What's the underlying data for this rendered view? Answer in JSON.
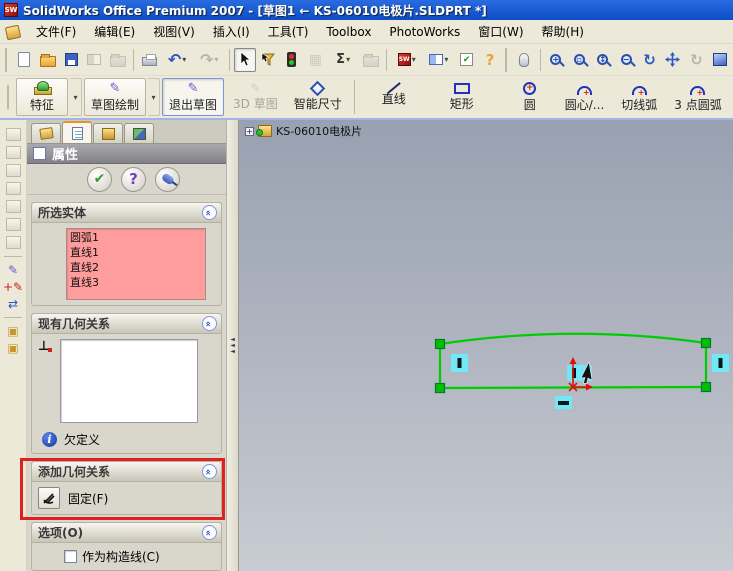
{
  "window": {
    "title": "SolidWorks Office Premium 2007 - [草图1 ← KS-06010电极片.SLDPRT *]"
  },
  "menu": {
    "items": [
      "文件(F)",
      "编辑(E)",
      "视图(V)",
      "插入(I)",
      "工具(T)",
      "Toolbox",
      "PhotoWorks",
      "窗口(W)",
      "帮助(H)"
    ]
  },
  "glyphs": {
    "undo": "↶",
    "redo": "↷",
    "dropdown": "▾",
    "sigma": "Σ",
    "help": "?",
    "rotate": "↻",
    "sw_logo": "SW",
    "grid": "▦",
    "pencil": "✎",
    "check": "✔",
    "zoom_fit": "+",
    "zoom_area": "▫",
    "zoom_inout": "↕",
    "zoom_sel": "−",
    "chevron": "»",
    "perpendicular": "⊥",
    "info": "i",
    "circle_plus": "+",
    "expand": "+",
    "three_d": "3D",
    "splitter": "◄"
  },
  "main_toolbar": {
    "icon_names": [
      "new",
      "open",
      "save",
      "make-drawing",
      "make-assembly",
      "print",
      "undo",
      "redo",
      "select",
      "selection-filter",
      "stop-macro",
      "grid",
      "measure",
      "unknown-disabled",
      "solidworks-resources",
      "split-window",
      "options",
      "help",
      "select-tool",
      "zoom-to-fit",
      "zoom-to-area",
      "zoom-in-out",
      "zoom-to-selection",
      "rotate-view",
      "pan",
      "view-disabled",
      "shaded-view"
    ]
  },
  "sketch_toolbar": {
    "features": "特征",
    "sketch": "草图绘制",
    "exit_sketch": "退出草图",
    "sketch_3d": "草图",
    "sketch_3d_prefix": "3D",
    "smart_dimension": "智能尺寸",
    "line": "直线",
    "rectangle": "矩形",
    "circle": "圆",
    "centerpoint_arc": "圆心/...",
    "tangent_arc": "切线弧",
    "three_point_arc": "3 点圆弧"
  },
  "panel": {
    "tabs": [
      "featuremanager",
      "propertymanager",
      "configurationmanager",
      "displaymanager"
    ],
    "header": "属性",
    "selected_entities": {
      "title": "所选实体",
      "items": [
        "圆弧1",
        "直线1",
        "直线2",
        "直线3"
      ]
    },
    "existing_relations": {
      "title": "现有几何关系",
      "status": "欠定义"
    },
    "add_relations": {
      "title": "添加几何关系",
      "fix": "固定(F)"
    },
    "options": {
      "title": "选项(O)",
      "construction": "作为构造线(C)"
    }
  },
  "graphics": {
    "tree_label": "KS-06010电极片",
    "relation_badges": [
      "vertical",
      "vertical",
      "vertical-cursor",
      "horizontal"
    ]
  },
  "colors": {
    "titlebar_blue": "#1C5FD6",
    "toolbar_tan": "#ECE9D8",
    "selection_pink": "#FF9C9C",
    "sketch_green": "#00CC00",
    "badge_cyan": "#6FE9F5",
    "origin_red": "#E01010",
    "annotation_red": "#DE2222",
    "viewport_top": "#99A1B1",
    "viewport_bottom": "#C8CCD2"
  }
}
